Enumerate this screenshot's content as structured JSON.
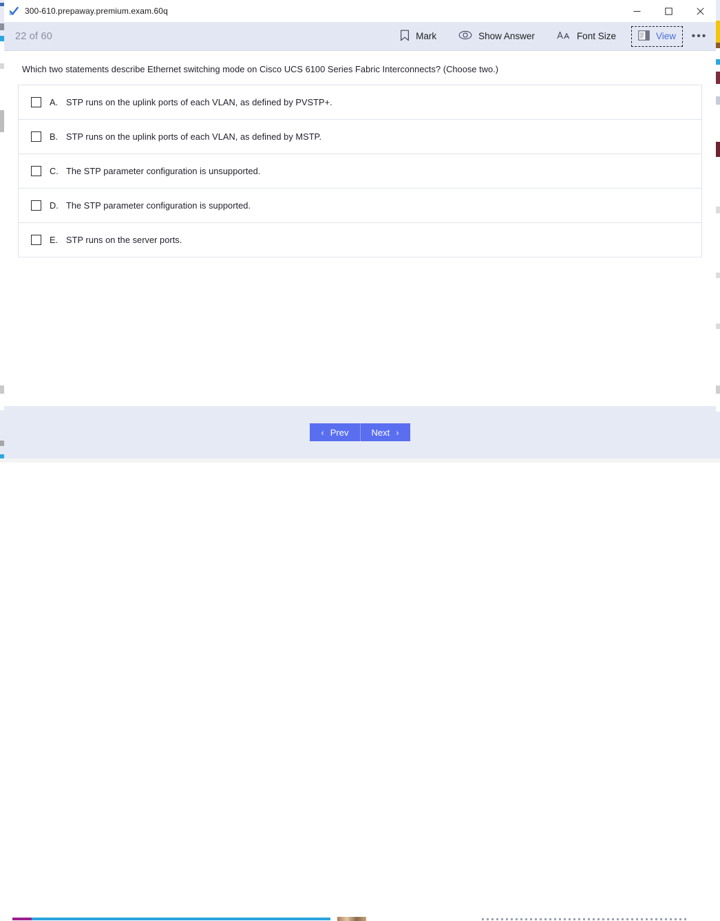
{
  "window": {
    "title": "300-610.prepaway.premium.exam.60q",
    "title_icon": "blue-check-icon",
    "controls": {
      "minimize": "–",
      "maximize": "☐",
      "close": "✕"
    }
  },
  "toolbar": {
    "counter": "22 of 60",
    "items": [
      {
        "label": "Mark",
        "icon": "bookmark-icon",
        "focused": false,
        "accent": false
      },
      {
        "label": "Show Answer",
        "icon": "eye-icon",
        "focused": false,
        "accent": false
      },
      {
        "label": "Font Size",
        "icon": "font-size-icon",
        "focused": false,
        "accent": false
      },
      {
        "label": "View",
        "icon": "layout-view-icon",
        "focused": true,
        "accent": true
      }
    ],
    "more_label": "•••"
  },
  "question": {
    "text": "Which two statements describe Ethernet switching mode on Cisco UCS 6100 Series Fabric Interconnects? (Choose two.)",
    "options": [
      {
        "letter": "A.",
        "text": "STP runs on the uplink ports of each VLAN, as defined by PVSTP+.",
        "checked": false
      },
      {
        "letter": "B.",
        "text": "STP runs on the uplink ports of each VLAN, as defined by MSTP.",
        "checked": false
      },
      {
        "letter": "C.",
        "text": "The STP parameter configuration is unsupported.",
        "checked": false
      },
      {
        "letter": "D.",
        "text": "The STP parameter configuration is supported.",
        "checked": false
      },
      {
        "letter": "E.",
        "text": "STP runs on the server ports.",
        "checked": false
      }
    ]
  },
  "footer": {
    "prev_label": "Prev",
    "next_label": "Next",
    "prev_chevron": "‹",
    "next_chevron": "›"
  },
  "colors": {
    "toolbar_bg": "#e3e7f4",
    "footer_bg": "#e6eaf4",
    "accent_blue": "#4a6fd4",
    "button_blue": "#5a6ef0",
    "counter_gray": "#8a8f9e",
    "option_border": "#dfe3ec"
  }
}
